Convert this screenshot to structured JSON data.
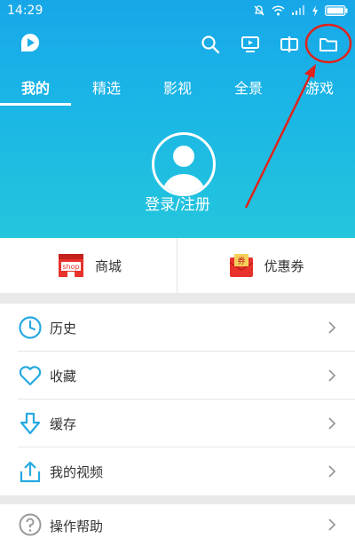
{
  "status": {
    "time": "14:29"
  },
  "tabs": [
    {
      "label": "我的",
      "active": true
    },
    {
      "label": "精选"
    },
    {
      "label": "影视"
    },
    {
      "label": "全景"
    },
    {
      "label": "游戏"
    }
  ],
  "header_icons": [
    "logo-icon",
    "search-icon",
    "tv-cast-icon",
    "mini-player-icon",
    "folder-icon"
  ],
  "profile": {
    "login_label": "登录/注册"
  },
  "quick_links": [
    {
      "label": "商城",
      "icon": "shop-icon",
      "icon_text": "shop"
    },
    {
      "label": "优惠券",
      "icon": "coupon-icon",
      "icon_text": "券"
    }
  ],
  "menu": [
    {
      "label": "历史",
      "icon": "history-clock-icon"
    },
    {
      "label": "收藏",
      "icon": "heart-icon"
    },
    {
      "label": "缓存",
      "icon": "download-icon"
    },
    {
      "label": "我的视频",
      "icon": "upload-icon"
    }
  ],
  "help": {
    "label": "操作帮助",
    "icon": "help-icon"
  },
  "colors": {
    "brand": "#1aaee8",
    "icon_blue": "#27a9e1",
    "annotation_red": "#e0231b",
    "coupon_red": "#e8322c"
  }
}
